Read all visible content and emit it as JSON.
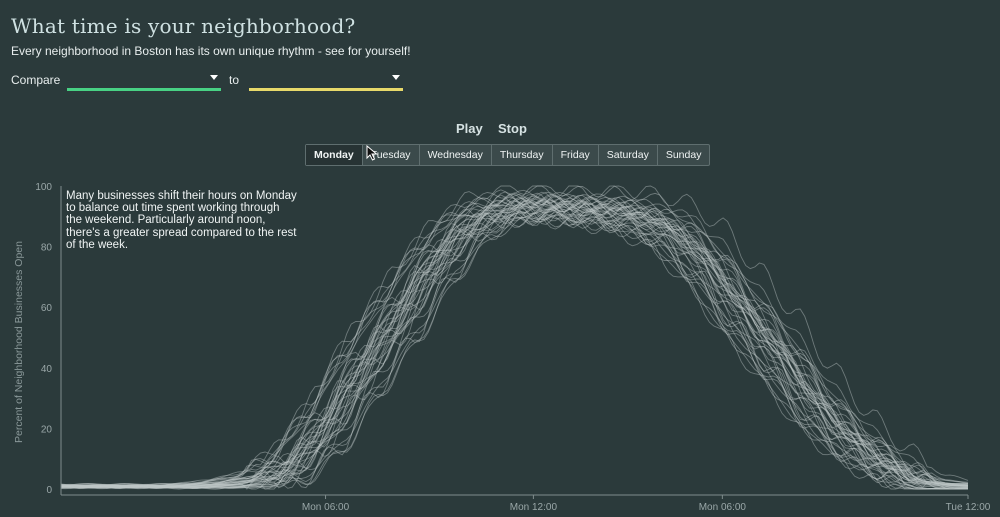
{
  "header": {
    "title": "What time is your neighborhood?",
    "subtitle": "Every neighborhood in Boston has its own unique rhythm - see for yourself!"
  },
  "compare": {
    "label": "Compare",
    "to_label": "to",
    "first_value": "",
    "second_value": "",
    "first_color": "#48d184",
    "second_color": "#e8d96a"
  },
  "controls": {
    "play_label": "Play",
    "stop_label": "Stop",
    "days": [
      "Monday",
      "Tuesday",
      "Wednesday",
      "Thursday",
      "Friday",
      "Saturday",
      "Sunday"
    ],
    "selected_day": "Monday"
  },
  "annotation": "Many businesses shift their hours on Monday to balance out time spent working through the weekend. Particularly around noon, there's a greater spread compared to the rest of the week.",
  "chart_data": {
    "type": "line",
    "ylabel": "Percent of Neighborhood Businesses Open",
    "ylim": [
      0,
      100
    ],
    "yticks": [
      0,
      20,
      40,
      60,
      80,
      100
    ],
    "x_tick_labels": [
      "Mon 06:00",
      "Mon 12:00",
      "Mon 06:00",
      "Tue 12:00"
    ],
    "x_hours": [
      0,
      3,
      4,
      5,
      6,
      7,
      8,
      9,
      10,
      11,
      12,
      13,
      14,
      15,
      16,
      17,
      18,
      19,
      20,
      21,
      22,
      23,
      24
    ],
    "typical_series_envelope": {
      "median": [
        1,
        1,
        1.5,
        3,
        8,
        22,
        42,
        60,
        78,
        90,
        94,
        94,
        93,
        92,
        88,
        78,
        62,
        47,
        30,
        17,
        8,
        2,
        1
      ],
      "spread": [
        0.5,
        0.5,
        1,
        2,
        5,
        8,
        9,
        9,
        7,
        5,
        4,
        4,
        4,
        5,
        6,
        8,
        9,
        9,
        8,
        6,
        4,
        2,
        1
      ]
    },
    "series_count": 40,
    "line_color": "#bfc7c7",
    "grid": false
  }
}
